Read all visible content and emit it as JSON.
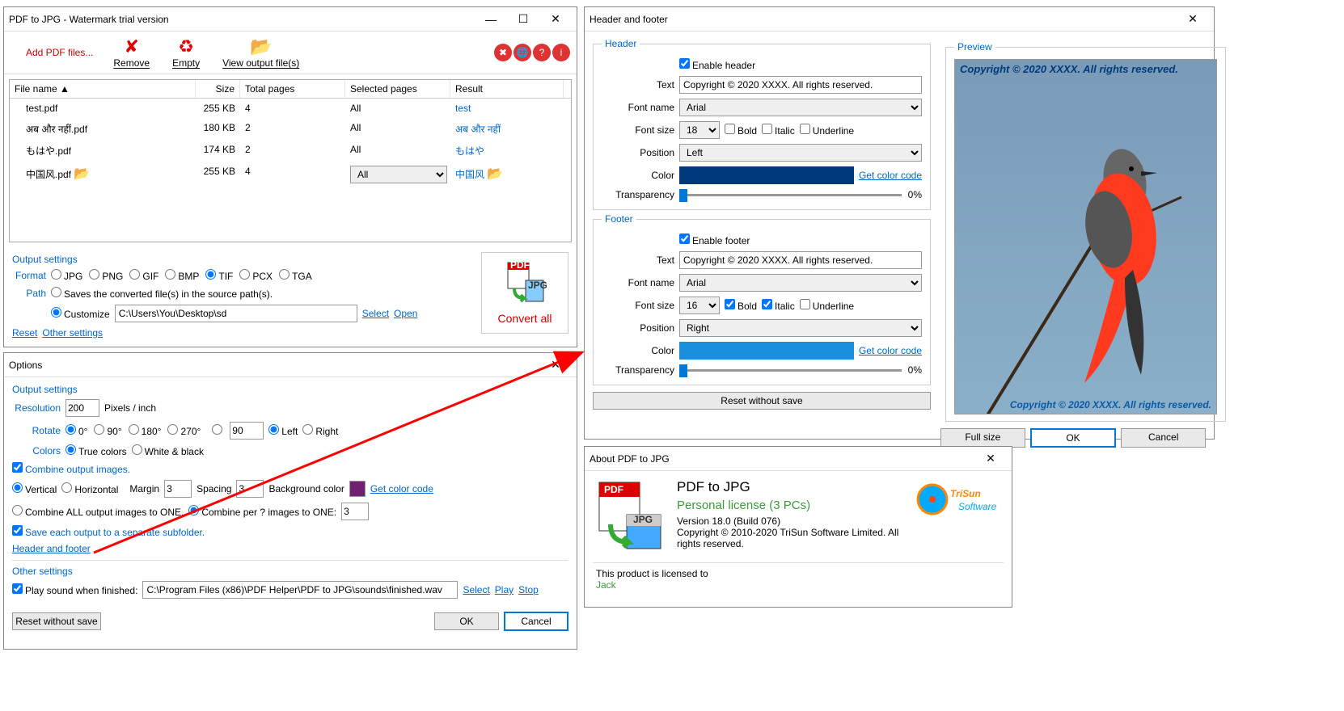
{
  "main": {
    "title": "PDF to JPG - Watermark trial version",
    "addFiles": "Add PDF files...",
    "remove": "Remove",
    "empty": "Empty",
    "viewOutput": "View output file(s)",
    "columns": {
      "name": "File name ▲",
      "size": "Size",
      "total": "Total pages",
      "selected": "Selected pages",
      "result": "Result"
    },
    "rows": [
      {
        "name": "test.pdf",
        "size": "255 KB",
        "total": "4",
        "selected": "All",
        "result": "test"
      },
      {
        "name": "अब और नहीं.pdf",
        "size": "180 KB",
        "total": "2",
        "selected": "All",
        "result": "अब और नहीं"
      },
      {
        "name": "もはや.pdf",
        "size": "174 KB",
        "total": "2",
        "selected": "All",
        "result": "もはや"
      },
      {
        "name": "中国风.pdf",
        "size": "255 KB",
        "total": "4",
        "selected": "All",
        "result": "中国风"
      }
    ],
    "outputSettings": "Output settings",
    "format": "Format",
    "formats": [
      "JPG",
      "PNG",
      "GIF",
      "BMP",
      "TIF",
      "PCX",
      "TGA"
    ],
    "path": "Path",
    "sourcePath": "Saves the converted file(s) in the source path(s).",
    "customize": "Customize",
    "customPath": "C:\\Users\\You\\Desktop\\sd",
    "select": "Select",
    "open": "Open",
    "reset": "Reset",
    "otherSettings": "Other settings",
    "convertAll": "Convert all"
  },
  "options": {
    "title": "Options",
    "outputSettings": "Output settings",
    "resolution": "Resolution",
    "resolutionVal": "200",
    "pixelsInch": "Pixels / inch",
    "rotate": "Rotate",
    "rotateOpts": [
      "0°",
      "90°",
      "180°",
      "270°"
    ],
    "rotateCustom": "90",
    "left": "Left",
    "right": "Right",
    "colors": "Colors",
    "trueColors": "True colors",
    "whiteBlack": "White & black",
    "combine": "Combine output images.",
    "vertical": "Vertical",
    "horizontal": "Horizontal",
    "margin": "Margin",
    "marginVal": "3",
    "spacing": "Spacing",
    "spacingVal": "3",
    "bgColor": "Background color",
    "getColorCode": "Get color code",
    "combineAll": "Combine ALL output images to ONE.",
    "combinePer": "Combine per ? images to ONE:",
    "combinePerVal": "3",
    "saveSub": "Save each output to a separate subfolder.",
    "headerFooter": "Header and footer",
    "otherSettings": "Other settings",
    "playSound": "Play sound when finished:",
    "soundPath": "C:\\Program Files (x86)\\PDF Helper\\PDF to JPG\\sounds\\finished.wav",
    "select": "Select",
    "play": "Play",
    "stop": "Stop",
    "resetWithoutSave": "Reset without save",
    "ok": "OK",
    "cancel": "Cancel"
  },
  "hf": {
    "title": "Header and footer",
    "headerLegend": "Header",
    "footerLegend": "Footer",
    "enableHeader": "Enable header",
    "enableFooter": "Enable footer",
    "text": "Text",
    "textVal": "Copyright © 2020 XXXX. All rights reserved.",
    "fontName": "Font name",
    "fontVal": "Arial",
    "fontSize": "Font size",
    "headerSize": "18",
    "footerSize": "16",
    "bold": "Bold",
    "italic": "Italic",
    "underline": "Underline",
    "position": "Position",
    "headerPos": "Left",
    "footerPos": "Right",
    "color": "Color",
    "getColorCode": "Get color code",
    "transparency": "Transparency",
    "transVal": "0%",
    "headerColor": "#003a7a",
    "footerColor": "#1b8fde",
    "preview": "Preview",
    "resetWithoutSave": "Reset without save",
    "fullSize": "Full size",
    "ok": "OK",
    "cancel": "Cancel"
  },
  "about": {
    "title": "About PDF to JPG",
    "product": "PDF to JPG",
    "license": "Personal license (3 PCs)",
    "version": "Version 18.0 (Build 076)",
    "copyright": "Copyright © 2010-2020 TriSun Software Limited. All rights reserved.",
    "licensedTo": "This product is licensed to",
    "user": "Jack",
    "company": "TriSun",
    "companySub": "Software"
  }
}
